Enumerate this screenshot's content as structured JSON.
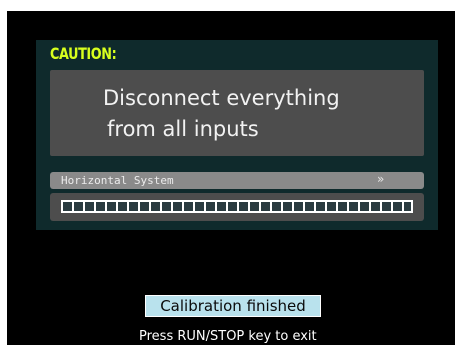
{
  "caution": {
    "label": "CAUTION:"
  },
  "message": {
    "line1": "Disconnect everything",
    "line2": "from all inputs"
  },
  "progress": {
    "title": "Horizontal System",
    "chevron": "»",
    "fraction": 1.0
  },
  "status": {
    "label": "Calibration finished"
  },
  "hint": {
    "text": "Press RUN/STOP key to exit"
  },
  "colors": {
    "caution": "#d8ff1e",
    "panel": "#0f2a2c",
    "box": "#4d4d4d",
    "status_bg": "#b9e2ed"
  }
}
